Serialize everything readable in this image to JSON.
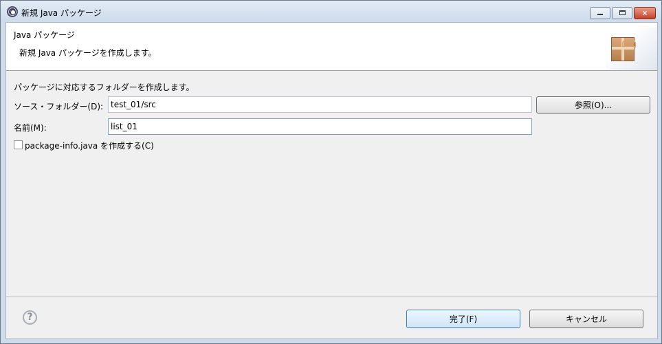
{
  "window": {
    "title": "新規 Java パッケージ",
    "controls": [
      "minimize",
      "maximize",
      "close"
    ]
  },
  "banner": {
    "title": "Java パッケージ",
    "description": "新規 Java パッケージを作成します。",
    "icon": "package-icon"
  },
  "form": {
    "intro": "パッケージに対応するフォルダーを作成します。",
    "source_folder_label": "ソース・フォルダー(D):",
    "source_folder_value": "test_01/src",
    "browse_label": "参照(O)...",
    "name_label": "名前(M):",
    "name_value": "list_01",
    "create_package_info_label": "package-info.java を作成する(C)",
    "create_package_info_checked": false
  },
  "footer": {
    "help_icon": "help-icon",
    "finish_label": "完了(F)",
    "cancel_label": "キャンセル"
  }
}
